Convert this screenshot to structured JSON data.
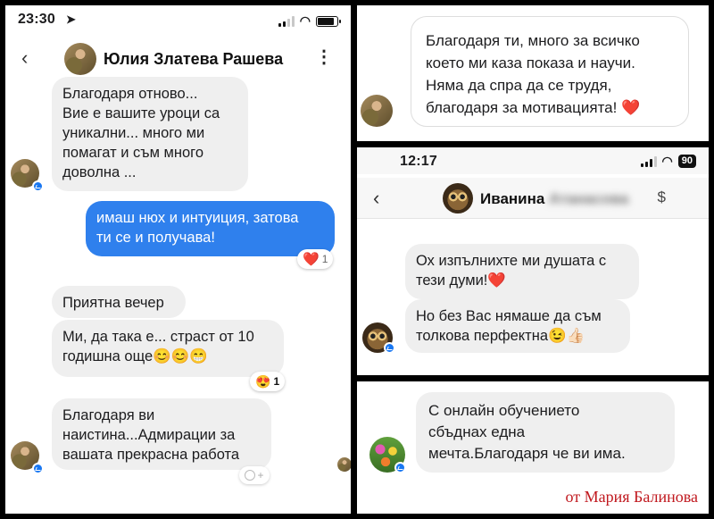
{
  "left": {
    "status_time": "23:30",
    "contact_name": "Юлия Златева Рашева",
    "messages": [
      {
        "text": "Благодаря отново...\nВие е вашите уроци са\nуникални... много ми\nпомагат и съм много\nдоволна ..."
      },
      {
        "text": "имаш нюх и интуиция, затова\nти се и получава!"
      },
      {
        "text": "Приятна вечер"
      },
      {
        "text": "Ми, да така е... страст от 10\nгодишна още😊😊😁"
      },
      {
        "text": "Благодаря ви\nнаистина...Адмирации за\nвашата прекрасна работа"
      }
    ],
    "reaction1": {
      "emoji": "❤️",
      "count": "1"
    },
    "reaction2": {
      "emoji": "😍",
      "count": "1"
    }
  },
  "top_right": {
    "message": "Благодаря ти, много за всичко\nкоето ми каза показа и научи.\nНяма да спра да се трудя,\nблагодаря за мотивацията! ❤️"
  },
  "mid_right": {
    "status_time": "12:17",
    "battery": "90",
    "contact_first": "Иванина",
    "contact_last_blurred": "Атанасова",
    "dollar": "$",
    "messages": [
      {
        "text": "Ох изпълнихте ми душата с\nтези думи!❤️"
      },
      {
        "text": "Но без Вас нямаше да съм\nтолкова перфектна😉👍🏻"
      }
    ]
  },
  "bottom_right": {
    "message": "С онлайн обучението\nсбъднах една\nмечта.Благодаря че ви има.",
    "signature": "от Мария Балинова"
  },
  "colors": {
    "accent_blue": "#2f80ed",
    "bubble_gray": "#efefef",
    "signature_red": "#c0181e"
  }
}
